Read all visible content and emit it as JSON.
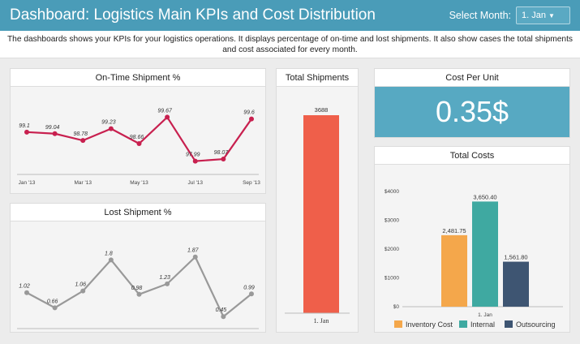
{
  "header": {
    "title": "Dashboard: Logistics Main KPIs and Cost Distribution",
    "select_label": "Select Month:",
    "selected_month": "1. Jan"
  },
  "description": "The dashboards shows your KPIs for your logistics operations. It displays percentage of on-time and lost shipments. It also show cases the total shipments and cost associated for every month.",
  "colors": {
    "header": "#4a9cb8",
    "ontime_line": "#c8204f",
    "lost_line": "#999999",
    "shipments_bar": "#ef5f4a",
    "cost_per_unit_bg": "#57a9c2",
    "inventory": "#f4a74b",
    "internal": "#3fa9a1",
    "outsourcing": "#3e5572"
  },
  "panels": {
    "ontime_title": "On-Time Shipment %",
    "lost_title": "Lost Shipment %",
    "shipments_title": "Total Shipments",
    "cpu_title": "Cost Per Unit",
    "costs_title": "Total Costs"
  },
  "cost_per_unit": "0.35$",
  "chart_data": [
    {
      "type": "line",
      "name": "ontime",
      "x_ticks": [
        "Jan '13",
        "Mar '13",
        "May '13",
        "Jul '13",
        "Sep '13"
      ],
      "points": [
        {
          "x": "Jan '13",
          "y": 99.1,
          "label": "99.1"
        },
        {
          "x": "Feb '13",
          "y": 99.04,
          "label": "99.04"
        },
        {
          "x": "Mar '13",
          "y": 98.78,
          "label": "98.78"
        },
        {
          "x": "Apr '13",
          "y": 99.23,
          "label": "99.23"
        },
        {
          "x": "May '13",
          "y": 98.66,
          "label": "98.66"
        },
        {
          "x": "Jun '13",
          "y": 99.67,
          "label": "99.67"
        },
        {
          "x": "Jul '13",
          "y": 97.99,
          "label": "97.99"
        },
        {
          "x": "Aug '13",
          "y": 98.07,
          "label": "98.07"
        },
        {
          "x": "Sep '13",
          "y": 99.6,
          "label": "99.6"
        }
      ]
    },
    {
      "type": "line",
      "name": "lost",
      "x_ticks": [
        "Jan '13",
        "Mar '13",
        "May '13",
        "Jul '13",
        "Sep '13"
      ],
      "points": [
        {
          "x": "Jan '13",
          "y": 1.02,
          "label": "1.02"
        },
        {
          "x": "Feb '13",
          "y": 0.66,
          "label": "0.66"
        },
        {
          "x": "Mar '13",
          "y": 1.06,
          "label": "1.06"
        },
        {
          "x": "Apr '13",
          "y": 1.8,
          "label": "1.8"
        },
        {
          "x": "May '13",
          "y": 0.98,
          "label": "0.98"
        },
        {
          "x": "Jun '13",
          "y": 1.23,
          "label": "1.23"
        },
        {
          "x": "Jul '13",
          "y": 1.87,
          "label": "1.87"
        },
        {
          "x": "Aug '13",
          "y": 0.45,
          "label": "0.45"
        },
        {
          "x": "Sep '13",
          "y": 0.99,
          "label": "0.99"
        }
      ]
    },
    {
      "type": "bar",
      "name": "shipments",
      "categories": [
        "1. Jan"
      ],
      "values": [
        3688
      ],
      "value_labels": [
        "3688"
      ]
    },
    {
      "type": "bar",
      "name": "costs",
      "categories": [
        "1. Jan"
      ],
      "ylim": [
        0,
        4000
      ],
      "y_ticks": [
        "$0",
        "$1000",
        "$2000",
        "$3000",
        "$4000"
      ],
      "series": [
        {
          "name": "Inventory Cost",
          "values": [
            2481.75
          ],
          "label": "2,481.75"
        },
        {
          "name": "Internal",
          "values": [
            3650.4
          ],
          "label": "3,650.40"
        },
        {
          "name": "Outsourcing",
          "values": [
            1561.8
          ],
          "label": "1,561.80"
        }
      ]
    }
  ]
}
